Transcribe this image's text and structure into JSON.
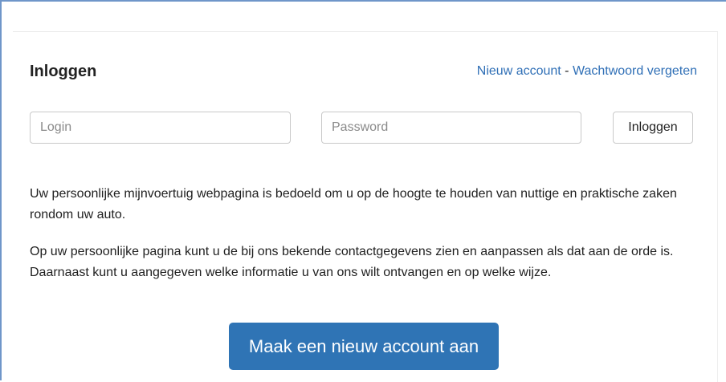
{
  "login_panel": {
    "title": "Inloggen",
    "links": {
      "new_account": "Nieuw account",
      "separator": " - ",
      "forgot_password": "Wachtwoord vergeten"
    },
    "login_field": {
      "placeholder": "Login",
      "value": ""
    },
    "password_field": {
      "placeholder": "Password",
      "value": ""
    },
    "login_button_label": "Inloggen",
    "paragraphs": [
      "Uw persoonlijke mijnvoertuig webpagina is bedoeld om u op de hoogte te houden van nuttige en praktische zaken rondom uw auto.",
      "Op uw persoonlijke pagina kunt u de bij ons bekende contactgegevens zien en aanpassen als dat aan de orde is. Daarnaast kunt u aangegeven welke informatie u van ons wilt ontvangen en op welke wijze."
    ],
    "create_account_button_label": "Maak een nieuw account aan"
  },
  "colors": {
    "link": "#2f6fb6",
    "primary_button": "#2f74b5",
    "frame_border": "#6f96c9"
  }
}
